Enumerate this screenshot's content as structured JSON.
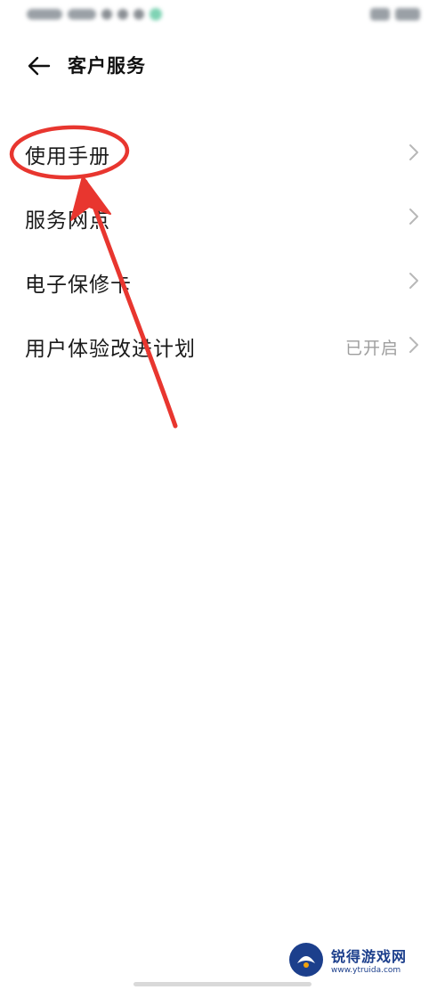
{
  "header": {
    "title": "客户服务",
    "back_icon": "arrow-left-icon"
  },
  "list": {
    "items": [
      {
        "label": "使用手册",
        "status": "",
        "icon": "chevron-right-icon"
      },
      {
        "label": "服务网点",
        "status": "",
        "icon": "chevron-right-icon"
      },
      {
        "label": "电子保修卡",
        "status": "",
        "icon": "chevron-right-icon"
      },
      {
        "label": "用户体验改进计划",
        "status": "已开启",
        "icon": "chevron-right-icon"
      }
    ]
  },
  "annotation": {
    "color": "#e8362f",
    "shapes": [
      "circle-highlight",
      "arrow"
    ]
  },
  "watermark": {
    "brand": "锐得游戏网",
    "url": "www.ytruida.com",
    "brand_color": "#1c3f8c"
  },
  "colors": {
    "title_text": "#111111",
    "item_text": "#1a1a1a",
    "status_text": "#9e9e9e",
    "chevron": "#b8b8b8"
  }
}
